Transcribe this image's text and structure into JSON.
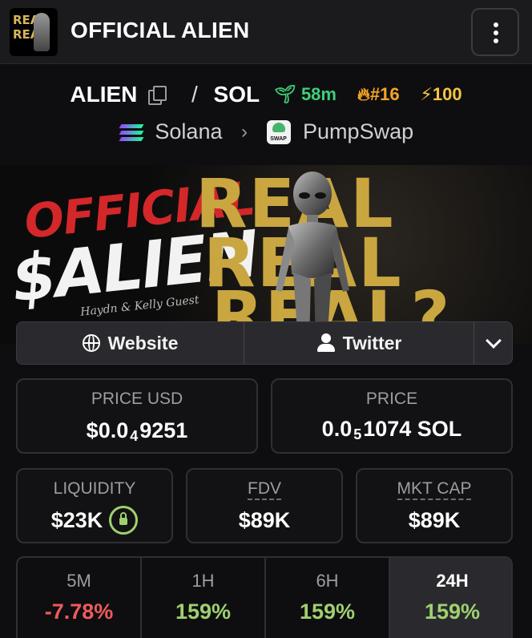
{
  "header": {
    "title": "OFFICIAL ALIEN",
    "logo_text": [
      "REAL",
      "REAL"
    ],
    "menu_icon": "kebab-menu-icon"
  },
  "pair": {
    "base": "ALIEN",
    "separator": "/",
    "quote": "SOL",
    "age": "58m",
    "rank": "#16",
    "boost": "100",
    "chain": "Solana",
    "dex": "PumpSwap",
    "dex_badge": "SWAP"
  },
  "banner": {
    "line1": "OFFICIAL",
    "line2": "$ALIEN",
    "real_words": [
      "REAL",
      "REAL",
      "REAL?"
    ],
    "signature": "Haydn & Kelly Guest"
  },
  "links": {
    "website": "Website",
    "twitter": "Twitter"
  },
  "stats": {
    "price_usd_label": "PRICE USD",
    "price_usd_prefix": "$0.0",
    "price_usd_sub": "4",
    "price_usd_digits": "9251",
    "price_label": "PRICE",
    "price_prefix": "0.0",
    "price_sub": "5",
    "price_digits": "1074 SOL",
    "liquidity_label": "LIQUIDITY",
    "liquidity": "$23K",
    "fdv_label": "FDV",
    "fdv": "$89K",
    "mktcap_label": "MKT CAP",
    "mktcap": "$89K"
  },
  "timeframes": [
    {
      "label": "5M",
      "value": "-7.78%"
    },
    {
      "label": "1H",
      "value": "159%"
    },
    {
      "label": "6H",
      "value": "159%"
    },
    {
      "label": "24H",
      "value": "159%"
    }
  ],
  "colors": {
    "positive": "#9fd06e",
    "negative": "#ef5a5a",
    "age": "#3fcf7a",
    "rank": "#f5a623",
    "boost": "#f5c542"
  }
}
